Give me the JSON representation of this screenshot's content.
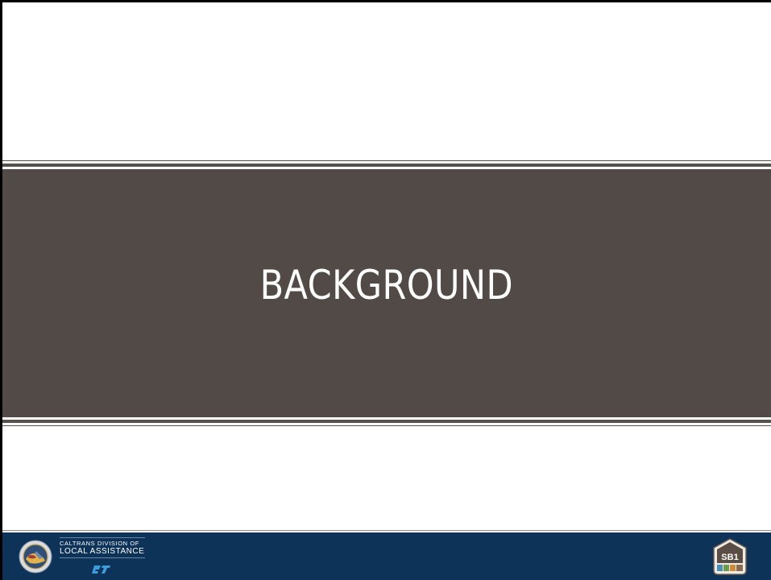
{
  "slide": {
    "title": "BACKGROUND"
  },
  "footer": {
    "org_line1": "CALTRANS DIVISION OF",
    "org_line2": "LOCAL ASSISTANCE",
    "badge_text": "SB1"
  },
  "colors": {
    "band": "#524a46",
    "footer": "#0d3359",
    "text": "#ffffff",
    "ct_logo": "#3b9ddb"
  },
  "icons": [
    "state-seal-icon",
    "caltrans-logo-icon",
    "sb1-shield-icon"
  ]
}
